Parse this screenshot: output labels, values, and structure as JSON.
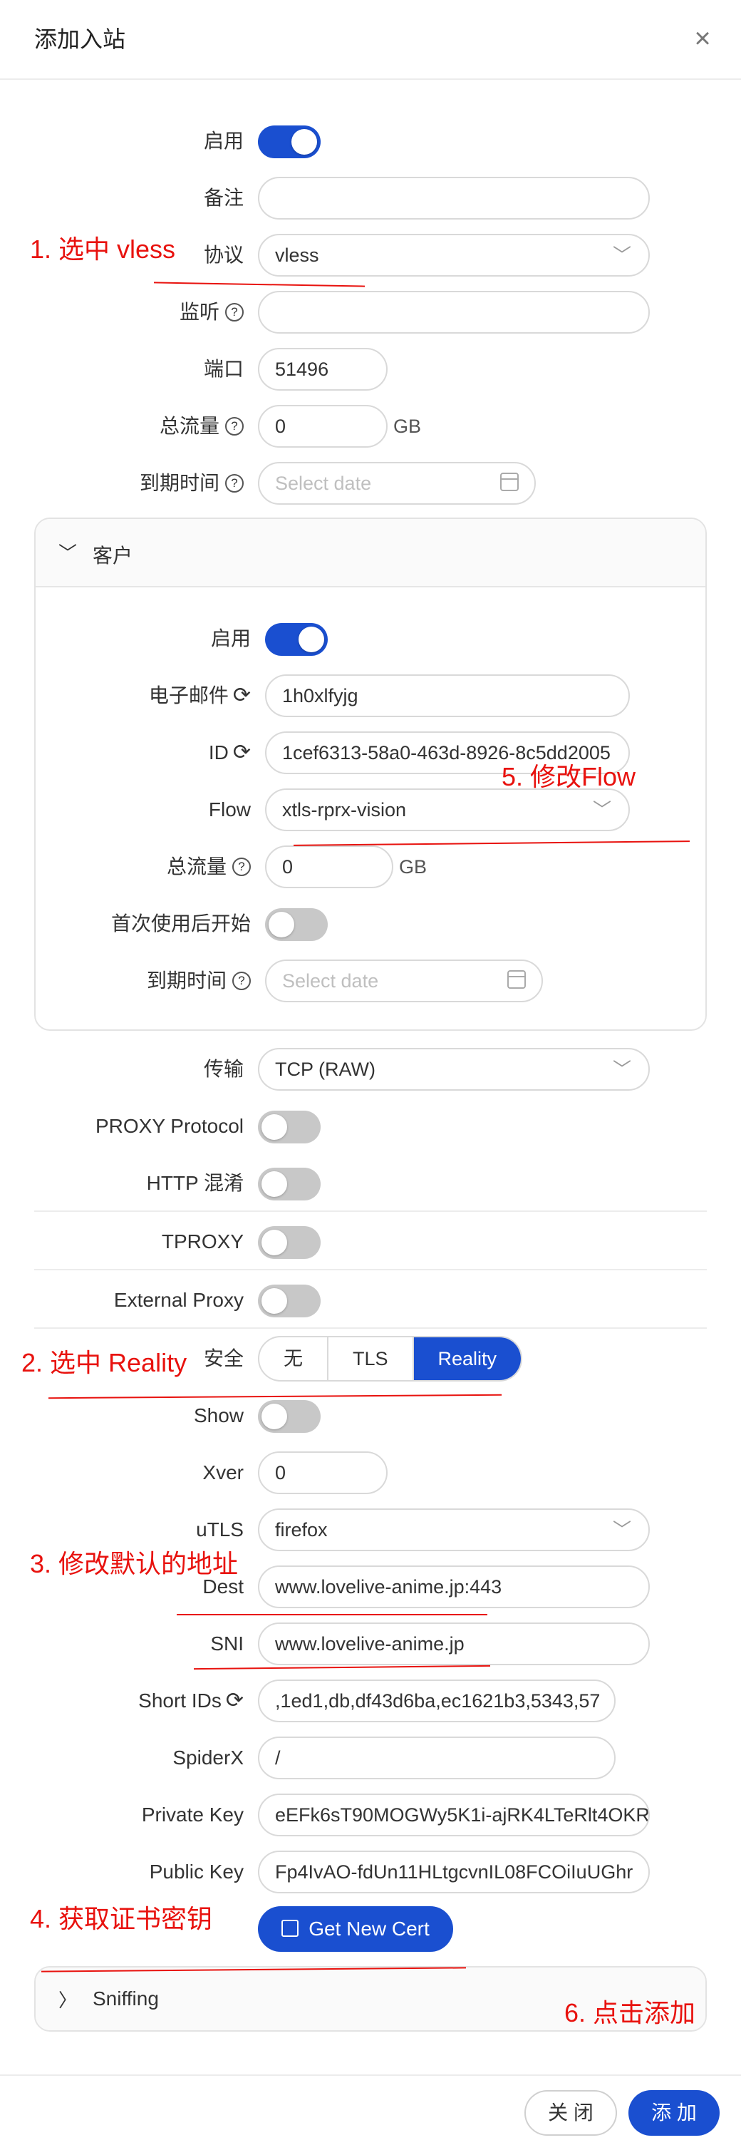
{
  "modal": {
    "title": "添加入站",
    "close": "×"
  },
  "fields": {
    "enable": "启用",
    "remark": "备注",
    "protocol": {
      "label": "协议",
      "value": "vless"
    },
    "listen": "监听",
    "port": {
      "label": "端口",
      "value": "51496"
    },
    "total_traffic": {
      "label": "总流量",
      "value": "0",
      "unit": "GB"
    },
    "expiry": {
      "label": "到期时间",
      "placeholder": "Select date"
    }
  },
  "client": {
    "title": "客户",
    "enable": "启用",
    "email": {
      "label": "电子邮件",
      "value": "1h0xlfyjg"
    },
    "id": {
      "label": "ID",
      "value": "1cef6313-58a0-463d-8926-8c5dd2005"
    },
    "flow": {
      "label": "Flow",
      "value": "xtls-rprx-vision"
    },
    "total_traffic": {
      "label": "总流量",
      "value": "0",
      "unit": "GB"
    },
    "start_after_first_use": "首次使用后开始",
    "expiry": {
      "label": "到期时间",
      "placeholder": "Select date"
    }
  },
  "transport": {
    "label": "传输",
    "value": "TCP (RAW)",
    "proxy_protocol": "PROXY Protocol",
    "http_obfs": "HTTP 混淆",
    "tproxy": "TPROXY",
    "external_proxy": "External Proxy"
  },
  "security": {
    "label": "安全",
    "options": [
      "无",
      "TLS",
      "Reality"
    ],
    "selected": "Reality"
  },
  "reality": {
    "show": "Show",
    "xver": {
      "label": "Xver",
      "value": "0"
    },
    "utls": {
      "label": "uTLS",
      "value": "firefox"
    },
    "dest": {
      "label": "Dest",
      "value": "www.lovelive-anime.jp:443"
    },
    "sni": {
      "label": "SNI",
      "value": "www.lovelive-anime.jp"
    },
    "short_ids": {
      "label": "Short IDs",
      "value": ",1ed1,db,df43d6ba,ec1621b3,5343,57"
    },
    "spiderx": {
      "label": "SpiderX",
      "value": "/"
    },
    "private_key": {
      "label": "Private Key",
      "value": "eEFk6sT90MOGWy5K1i-ajRK4LTeRlt4OKR"
    },
    "public_key": {
      "label": "Public Key",
      "value": "Fp4IvAO-fdUn11HLtgcvnIL08FCOiIuUGhr"
    },
    "get_cert": "Get New Cert"
  },
  "sniffing": {
    "title": "Sniffing"
  },
  "footer": {
    "close": "关 闭",
    "add": "添 加"
  },
  "annotations": {
    "a1": "1. 选中 vless",
    "a2": "2. 选中 Reality",
    "a3": "3. 修改默认的地址",
    "a4": "4. 获取证书密钥",
    "a5": "5. 修改Flow",
    "a6": "6. 点击添加"
  },
  "colors": {
    "primary": "#1a4fd0",
    "annotation": "#e8120e"
  },
  "icons": {
    "help": "question-circle-icon",
    "sync": "sync-icon",
    "calendar": "calendar-icon",
    "chevron": "chevron-down-icon",
    "cert": "import-icon"
  }
}
